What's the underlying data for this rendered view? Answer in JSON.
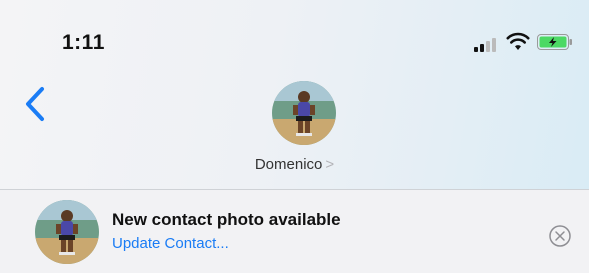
{
  "status_bar": {
    "time": "1:11",
    "signal_icon": "cellular-signal-icon",
    "wifi_icon": "wifi-icon",
    "battery_icon": "battery-charging-icon",
    "battery_color": "#4cd964"
  },
  "header": {
    "back_icon": "chevron-left-icon",
    "contact_name": "Domenico",
    "contact_chevron": ">"
  },
  "banner": {
    "title": "New contact photo available",
    "link_text": "Update Contact...",
    "close_icon": "close-circle-icon"
  },
  "colors": {
    "accent": "#1a7cf5",
    "divider": "#cfd2d6"
  }
}
